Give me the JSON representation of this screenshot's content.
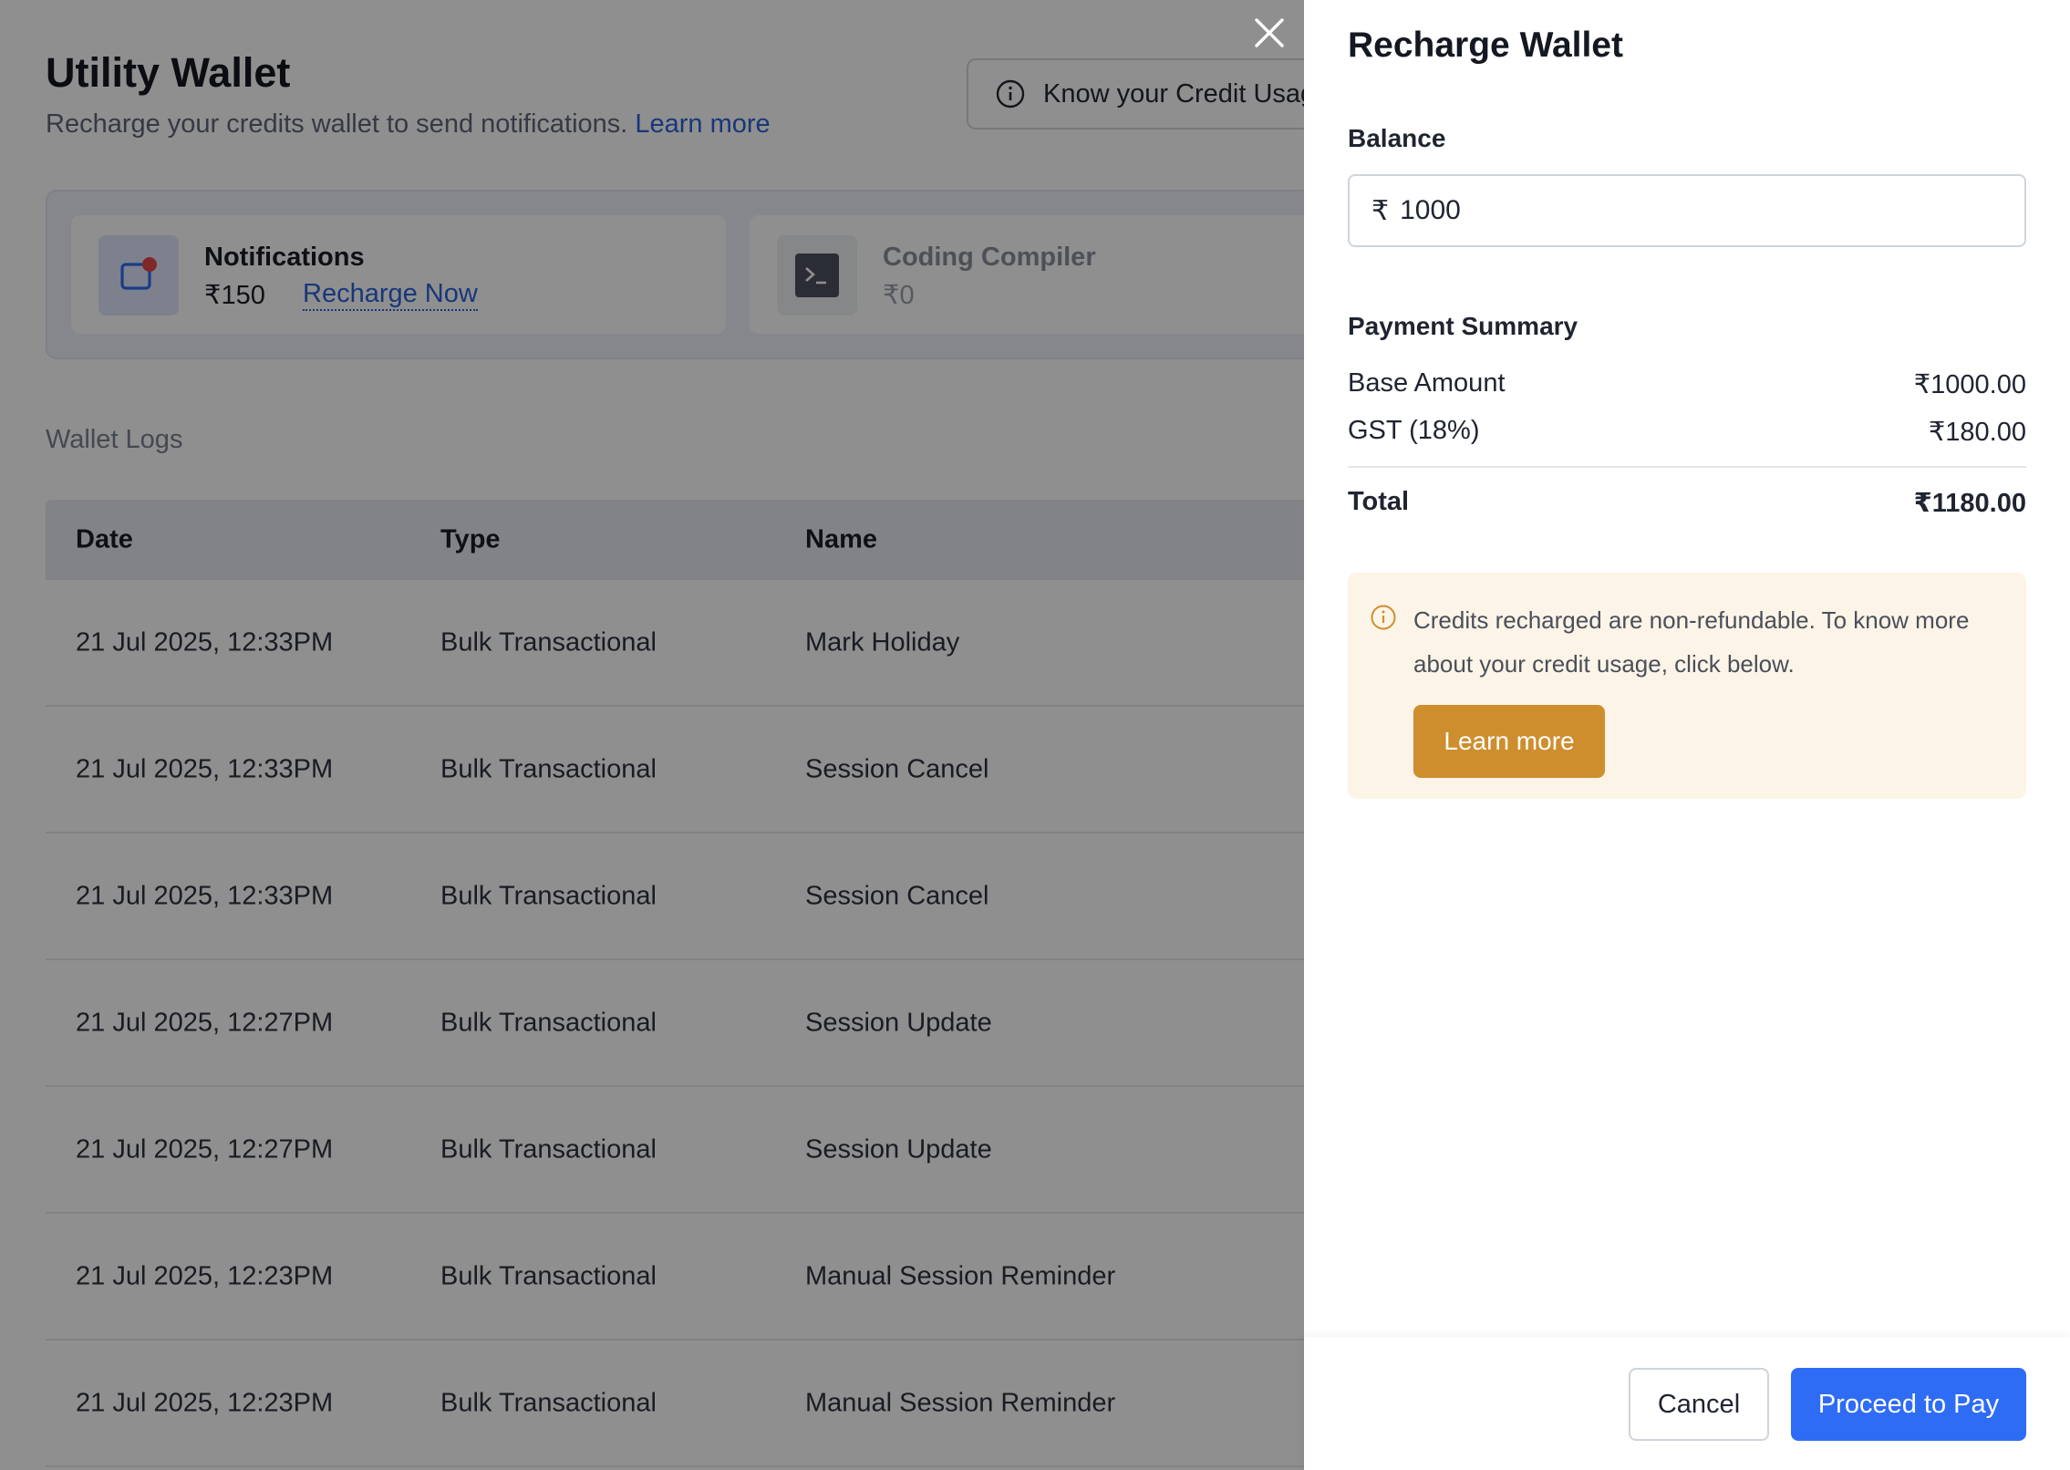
{
  "page": {
    "title": "Utility Wallet",
    "subtitle": "Recharge your credits wallet to send notifications.",
    "subtitle_link": "Learn more",
    "credit_usage_button": "Know your Credit Usag"
  },
  "wallets": {
    "notifications": {
      "name": "Notifications",
      "amount": "₹150",
      "action": "Recharge Now"
    },
    "coding_compiler": {
      "name": "Coding Compiler",
      "amount": "₹0"
    }
  },
  "logs": {
    "title": "Wallet Logs",
    "columns": [
      "Date",
      "Type",
      "Name"
    ],
    "rows": [
      [
        "21 Jul 2025, 12:33PM",
        "Bulk Transactional",
        "Mark Holiday"
      ],
      [
        "21 Jul 2025, 12:33PM",
        "Bulk Transactional",
        "Session Cancel"
      ],
      [
        "21 Jul 2025, 12:33PM",
        "Bulk Transactional",
        "Session Cancel"
      ],
      [
        "21 Jul 2025, 12:27PM",
        "Bulk Transactional",
        "Session Update"
      ],
      [
        "21 Jul 2025, 12:27PM",
        "Bulk Transactional",
        "Session Update"
      ],
      [
        "21 Jul 2025, 12:23PM",
        "Bulk Transactional",
        "Manual Session Reminder"
      ],
      [
        "21 Jul 2025, 12:23PM",
        "Bulk Transactional",
        "Manual Session Reminder"
      ]
    ]
  },
  "drawer": {
    "title": "Recharge Wallet",
    "balance_label": "Balance",
    "currency_symbol": "₹",
    "balance_value": "1000",
    "summary_title": "Payment Summary",
    "base_label": "Base Amount",
    "base_value": "₹1000.00",
    "gst_label": "GST (18%)",
    "gst_value": "₹180.00",
    "total_label": "Total",
    "total_value": "₹1180.00",
    "notice_text": "Credits recharged are non-refundable. To know more about your credit usage, click below.",
    "notice_button": "Learn more",
    "cancel_label": "Cancel",
    "pay_label": "Proceed to Pay"
  },
  "colors": {
    "primary": "#2f6cf6",
    "link": "#2b63d9",
    "warning": "#cf8e2e",
    "notice_bg": "#fcf4e7",
    "overlay": "rgba(0,0,0,0.44)"
  },
  "icons": [
    "info-icon",
    "notification-icon",
    "terminal-icon",
    "close-icon",
    "warning-info-icon"
  ]
}
